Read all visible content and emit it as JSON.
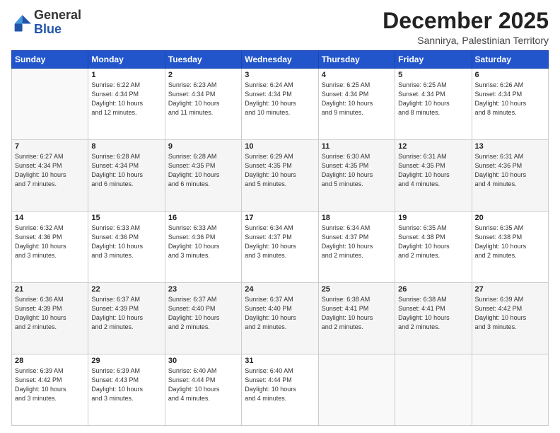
{
  "logo": {
    "general": "General",
    "blue": "Blue"
  },
  "header": {
    "month": "December 2025",
    "location": "Sannirya, Palestinian Territory"
  },
  "days_of_week": [
    "Sunday",
    "Monday",
    "Tuesday",
    "Wednesday",
    "Thursday",
    "Friday",
    "Saturday"
  ],
  "weeks": [
    [
      {
        "day": "",
        "info": ""
      },
      {
        "day": "1",
        "info": "Sunrise: 6:22 AM\nSunset: 4:34 PM\nDaylight: 10 hours\nand 12 minutes."
      },
      {
        "day": "2",
        "info": "Sunrise: 6:23 AM\nSunset: 4:34 PM\nDaylight: 10 hours\nand 11 minutes."
      },
      {
        "day": "3",
        "info": "Sunrise: 6:24 AM\nSunset: 4:34 PM\nDaylight: 10 hours\nand 10 minutes."
      },
      {
        "day": "4",
        "info": "Sunrise: 6:25 AM\nSunset: 4:34 PM\nDaylight: 10 hours\nand 9 minutes."
      },
      {
        "day": "5",
        "info": "Sunrise: 6:25 AM\nSunset: 4:34 PM\nDaylight: 10 hours\nand 8 minutes."
      },
      {
        "day": "6",
        "info": "Sunrise: 6:26 AM\nSunset: 4:34 PM\nDaylight: 10 hours\nand 8 minutes."
      }
    ],
    [
      {
        "day": "7",
        "info": "Sunrise: 6:27 AM\nSunset: 4:34 PM\nDaylight: 10 hours\nand 7 minutes."
      },
      {
        "day": "8",
        "info": "Sunrise: 6:28 AM\nSunset: 4:34 PM\nDaylight: 10 hours\nand 6 minutes."
      },
      {
        "day": "9",
        "info": "Sunrise: 6:28 AM\nSunset: 4:35 PM\nDaylight: 10 hours\nand 6 minutes."
      },
      {
        "day": "10",
        "info": "Sunrise: 6:29 AM\nSunset: 4:35 PM\nDaylight: 10 hours\nand 5 minutes."
      },
      {
        "day": "11",
        "info": "Sunrise: 6:30 AM\nSunset: 4:35 PM\nDaylight: 10 hours\nand 5 minutes."
      },
      {
        "day": "12",
        "info": "Sunrise: 6:31 AM\nSunset: 4:35 PM\nDaylight: 10 hours\nand 4 minutes."
      },
      {
        "day": "13",
        "info": "Sunrise: 6:31 AM\nSunset: 4:36 PM\nDaylight: 10 hours\nand 4 minutes."
      }
    ],
    [
      {
        "day": "14",
        "info": "Sunrise: 6:32 AM\nSunset: 4:36 PM\nDaylight: 10 hours\nand 3 minutes."
      },
      {
        "day": "15",
        "info": "Sunrise: 6:33 AM\nSunset: 4:36 PM\nDaylight: 10 hours\nand 3 minutes."
      },
      {
        "day": "16",
        "info": "Sunrise: 6:33 AM\nSunset: 4:36 PM\nDaylight: 10 hours\nand 3 minutes."
      },
      {
        "day": "17",
        "info": "Sunrise: 6:34 AM\nSunset: 4:37 PM\nDaylight: 10 hours\nand 3 minutes."
      },
      {
        "day": "18",
        "info": "Sunrise: 6:34 AM\nSunset: 4:37 PM\nDaylight: 10 hours\nand 2 minutes."
      },
      {
        "day": "19",
        "info": "Sunrise: 6:35 AM\nSunset: 4:38 PM\nDaylight: 10 hours\nand 2 minutes."
      },
      {
        "day": "20",
        "info": "Sunrise: 6:35 AM\nSunset: 4:38 PM\nDaylight: 10 hours\nand 2 minutes."
      }
    ],
    [
      {
        "day": "21",
        "info": "Sunrise: 6:36 AM\nSunset: 4:39 PM\nDaylight: 10 hours\nand 2 minutes."
      },
      {
        "day": "22",
        "info": "Sunrise: 6:37 AM\nSunset: 4:39 PM\nDaylight: 10 hours\nand 2 minutes."
      },
      {
        "day": "23",
        "info": "Sunrise: 6:37 AM\nSunset: 4:40 PM\nDaylight: 10 hours\nand 2 minutes."
      },
      {
        "day": "24",
        "info": "Sunrise: 6:37 AM\nSunset: 4:40 PM\nDaylight: 10 hours\nand 2 minutes."
      },
      {
        "day": "25",
        "info": "Sunrise: 6:38 AM\nSunset: 4:41 PM\nDaylight: 10 hours\nand 2 minutes."
      },
      {
        "day": "26",
        "info": "Sunrise: 6:38 AM\nSunset: 4:41 PM\nDaylight: 10 hours\nand 2 minutes."
      },
      {
        "day": "27",
        "info": "Sunrise: 6:39 AM\nSunset: 4:42 PM\nDaylight: 10 hours\nand 3 minutes."
      }
    ],
    [
      {
        "day": "28",
        "info": "Sunrise: 6:39 AM\nSunset: 4:42 PM\nDaylight: 10 hours\nand 3 minutes."
      },
      {
        "day": "29",
        "info": "Sunrise: 6:39 AM\nSunset: 4:43 PM\nDaylight: 10 hours\nand 3 minutes."
      },
      {
        "day": "30",
        "info": "Sunrise: 6:40 AM\nSunset: 4:44 PM\nDaylight: 10 hours\nand 4 minutes."
      },
      {
        "day": "31",
        "info": "Sunrise: 6:40 AM\nSunset: 4:44 PM\nDaylight: 10 hours\nand 4 minutes."
      },
      {
        "day": "",
        "info": ""
      },
      {
        "day": "",
        "info": ""
      },
      {
        "day": "",
        "info": ""
      }
    ]
  ]
}
